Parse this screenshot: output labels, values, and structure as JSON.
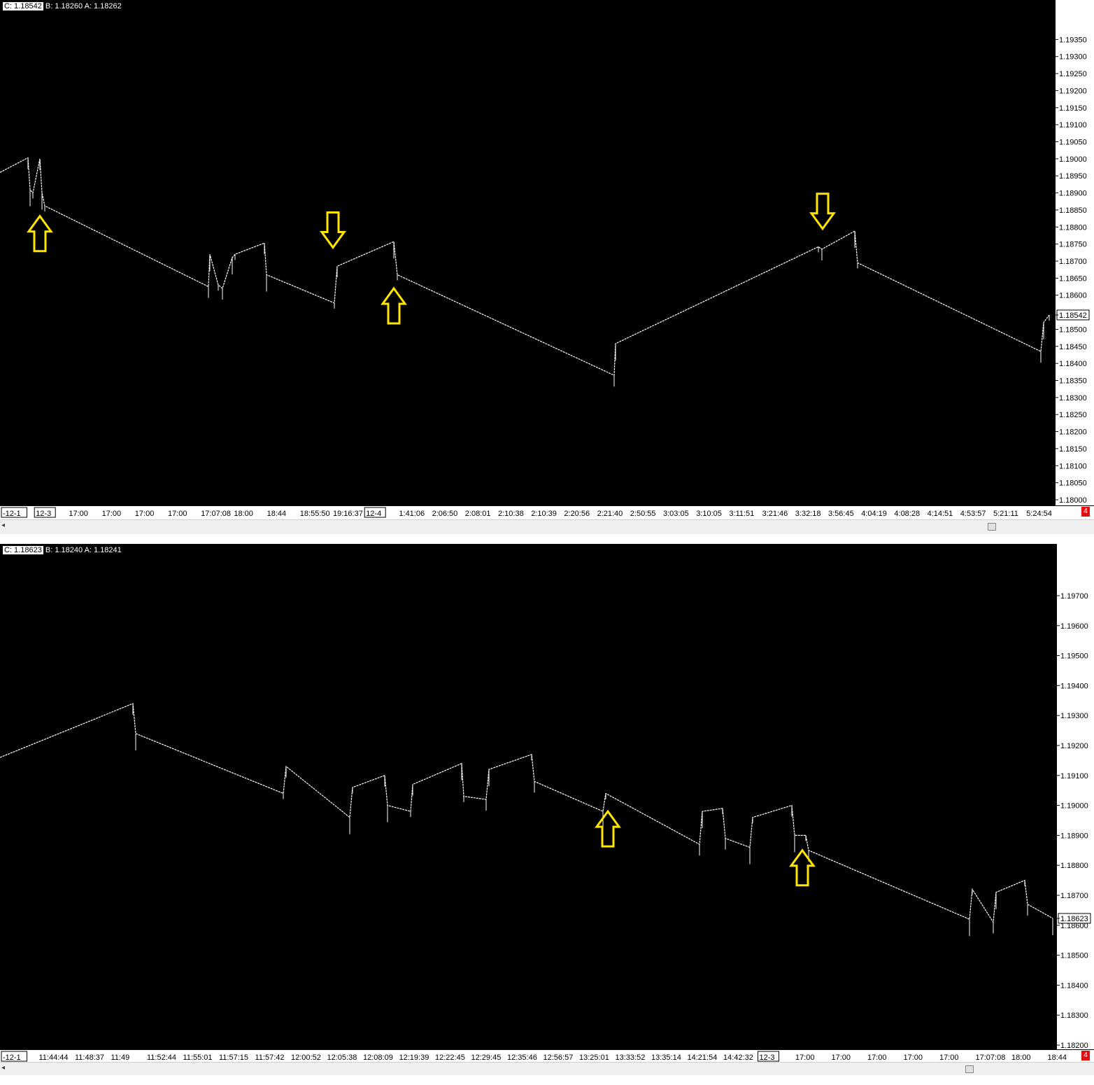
{
  "top_panel": {
    "info": {
      "close": "C: 1.18542",
      "bid": "B: 1.18260",
      "ask": "A: 1.18262"
    },
    "badge": "4"
  },
  "bottom_panel": {
    "info": {
      "close": "C: 1.18623",
      "bid": "B: 1.18240",
      "ask": "A: 1.18241"
    },
    "badge": "4"
  },
  "colors": {
    "background": "#000000",
    "line": "#ffffff",
    "arrows": "#ffe600",
    "badge": "#e01010"
  },
  "icons": [
    "arrow-up-icon",
    "arrow-down-icon",
    "scroll-left-icon"
  ],
  "chart_data": [
    {
      "type": "line",
      "ylim": [
        1.18,
        1.194
      ],
      "yticks": [
        "1.19350",
        "1.19300",
        "1.19250",
        "1.19200",
        "1.19150",
        "1.19100",
        "1.19050",
        "1.19000",
        "1.18950",
        "1.18900",
        "1.18850",
        "1.18800",
        "1.18750",
        "1.18700",
        "1.18650",
        "1.18600",
        "1.18542",
        "1.18500",
        "1.18450",
        "1.18400",
        "1.18350",
        "1.18300",
        "1.18250",
        "1.18200",
        "1.18150",
        "1.18100",
        "1.18050",
        "1.18000"
      ],
      "xticks": [
        "-12-1",
        "12-3",
        "17:00",
        "17:00",
        "17:00",
        "17:00",
        "17:07:08",
        "18:00",
        "18:44",
        "18:55:50",
        "19:16:37",
        "12-4",
        "1:41:06",
        "2:06:50",
        "2:08:01",
        "2:10:38",
        "2:10:39",
        "2:20:56",
        "2:21:40",
        "2:50:55",
        "3:03:05",
        "3:10:05",
        "3:11:51",
        "3:21:46",
        "3:32:18",
        "3:56:45",
        "4:04:19",
        "4:08:28",
        "4:14:51",
        "4:53:57",
        "5:21:11",
        "5:24:54"
      ],
      "last_price": "1.18542",
      "series": [
        {
          "x": [
            0,
            40,
            43,
            47,
            57,
            60,
            64,
            298,
            300,
            312,
            318,
            332,
            336,
            378,
            381,
            478,
            482,
            563,
            568,
            878,
            880,
            1170,
            1175,
            1222,
            1226,
            1488,
            1492,
            1500
          ],
          "y": [
            1.1896,
            1.19003,
            1.1891,
            1.189,
            1.19,
            1.189,
            1.18862,
            1.18625,
            1.1872,
            1.1863,
            1.1862,
            1.1871,
            1.1872,
            1.18753,
            1.1866,
            1.18577,
            1.18685,
            1.18757,
            1.1866,
            1.18365,
            1.18458,
            1.18742,
            1.18735,
            1.18788,
            1.18695,
            1.18435,
            1.1852,
            1.18542
          ]
        }
      ],
      "arrows": [
        {
          "dir": "up",
          "x": 57,
          "y": 1.18832
        },
        {
          "dir": "down",
          "x": 476,
          "y": 1.1874
        },
        {
          "dir": "up",
          "x": 563,
          "y": 1.1862
        },
        {
          "dir": "down",
          "x": 1176,
          "y": 1.18795
        }
      ]
    },
    {
      "type": "line",
      "ylim": [
        1.182,
        1.1977
      ],
      "yticks": [
        "1.19700",
        "1.19600",
        "1.19500",
        "1.19400",
        "1.19300",
        "1.19200",
        "1.19100",
        "1.19000",
        "1.18900",
        "1.18800",
        "1.18700",
        "1.18623",
        "1.18600",
        "1.18500",
        "1.18400",
        "1.18300",
        "1.18200"
      ],
      "xticks": [
        "-12-1",
        "11:44:44",
        "11:48:37",
        "11:49",
        "11:52:44",
        "11:55:01",
        "11:57:15",
        "11:57:42",
        "12:00:52",
        "12:05:38",
        "12:08:09",
        "12:19:39",
        "12:22:45",
        "12:29:45",
        "12:35:46",
        "12:56:57",
        "13:25:01",
        "13:33:52",
        "13:35:14",
        "14:21:54",
        "14:42:32",
        "12-3",
        "17:00",
        "17:00",
        "17:00",
        "17:00",
        "17:00",
        "17:07:08",
        "18:00",
        "18:44"
      ],
      "last_price": "1.18623",
      "series": [
        {
          "x": [
            0,
            190,
            194,
            405,
            409,
            500,
            504,
            550,
            554,
            587,
            590,
            660,
            663,
            695,
            699,
            760,
            764,
            862,
            866,
            1000,
            1004,
            1033,
            1037,
            1072,
            1076,
            1132,
            1136,
            1152,
            1156,
            1386,
            1390,
            1420,
            1424,
            1465,
            1469,
            1505
          ],
          "y": [
            1.1916,
            1.1934,
            1.1924,
            1.1904,
            1.1913,
            1.1896,
            1.1906,
            1.191,
            1.19,
            1.1898,
            1.1907,
            1.1914,
            1.1903,
            1.1902,
            1.1912,
            1.1917,
            1.1908,
            1.1898,
            1.1904,
            1.1887,
            1.1898,
            1.1899,
            1.1889,
            1.1886,
            1.1896,
            1.19,
            1.189,
            1.189,
            1.1885,
            1.1862,
            1.1872,
            1.1861,
            1.1871,
            1.1875,
            1.1867,
            1.18623
          ]
        }
      ],
      "arrows": [
        {
          "dir": "up",
          "x": 869,
          "y": 1.1898
        },
        {
          "dir": "up",
          "x": 1147,
          "y": 1.1885
        }
      ]
    }
  ]
}
